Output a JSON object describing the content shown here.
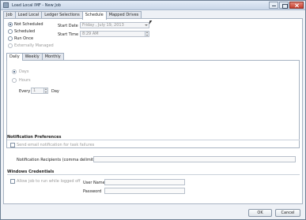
{
  "window": {
    "title": "Load Local IMF - New Job"
  },
  "tabs": [
    {
      "label": "Job",
      "active": false
    },
    {
      "label": "Load Local",
      "active": false
    },
    {
      "label": "Ledger Selections",
      "active": false
    },
    {
      "label": "Schedule",
      "active": true
    },
    {
      "label": "Mapped Drives",
      "active": false
    }
  ],
  "schedule": {
    "options": [
      {
        "label": "Not Scheduled",
        "selected": true,
        "enabled": true
      },
      {
        "label": "Scheduled",
        "selected": false,
        "enabled": true
      },
      {
        "label": "Run Once",
        "selected": false,
        "enabled": true
      },
      {
        "label": "Externally Managed",
        "selected": false,
        "enabled": false
      }
    ],
    "start_date_label": "Start Date",
    "start_date_value": "Friday ,   July   19, 2013",
    "start_time_label": "Start Time",
    "start_time_value": "8:29 AM"
  },
  "recurrence": {
    "tabs": [
      {
        "label": "Daily",
        "active": true
      },
      {
        "label": "Weekly",
        "active": false
      },
      {
        "label": "Monthly",
        "active": false
      }
    ],
    "days_label": "Days",
    "hours_label": "Hours",
    "every_label": "Every",
    "every_value": "1",
    "unit_label": "Day"
  },
  "notification": {
    "title": "Notification Preferences",
    "send_email_label": "Send email notification for task failures",
    "recipients_label": "Notification Recipients (comma delimited list)",
    "recipients_value": ""
  },
  "credentials": {
    "title": "Windows Credentials",
    "allow_label": "Allow job to run while logged off",
    "username_label": "User Name",
    "username_value": "",
    "password_label": "Password",
    "password_value": ""
  },
  "footer": {
    "ok_label": "OK",
    "cancel_label": "Cancel"
  }
}
